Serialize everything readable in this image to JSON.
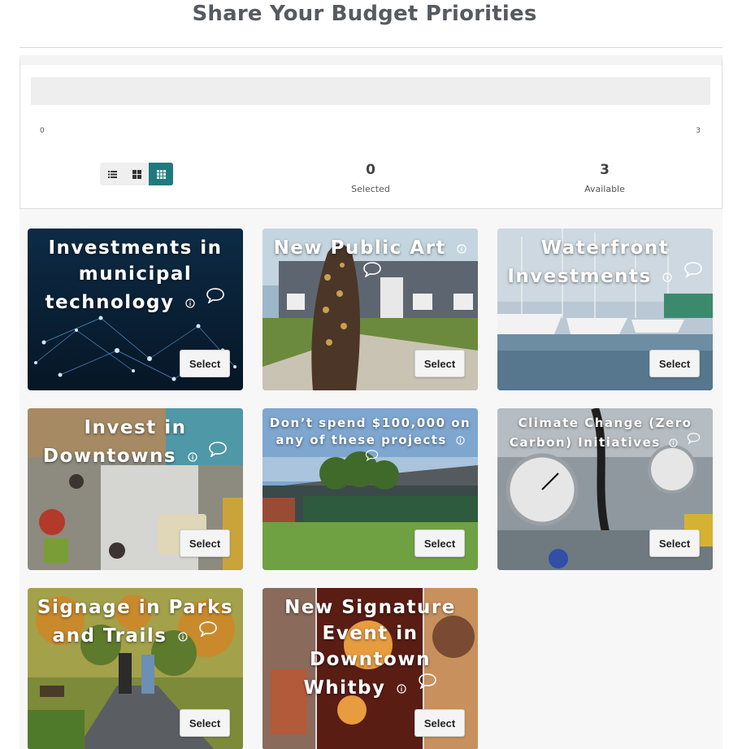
{
  "page": {
    "title": "Share Your Budget Priorities"
  },
  "progress": {
    "min_label": "0",
    "max_label": "3",
    "selected_count": 0,
    "max": 3
  },
  "view_toggle": {
    "options": [
      "list-icon",
      "large-grid-icon",
      "small-grid-icon"
    ],
    "active": "small-grid-icon",
    "active_color": "#1f7a80"
  },
  "stats": {
    "selected": {
      "value": "0",
      "label": "Selected"
    },
    "available": {
      "value": "3",
      "label": "Available"
    }
  },
  "cards": [
    {
      "title": "Investments in municipal technology",
      "select_label": "Select"
    },
    {
      "title": "New Public Art",
      "select_label": "Select"
    },
    {
      "title": "Waterfront Investments",
      "select_label": "Select"
    },
    {
      "title": "Invest in Downtowns",
      "select_label": "Select"
    },
    {
      "title": "Don’t spend $100,000 on any of these projects",
      "select_label": "Select"
    },
    {
      "title": "Climate Change (Zero Carbon) Initiatives",
      "select_label": "Select"
    },
    {
      "title": "Signage in Parks and Trails",
      "select_label": "Select"
    },
    {
      "title": "New Signature Event in Downtown Whitby",
      "select_label": "Select"
    }
  ]
}
